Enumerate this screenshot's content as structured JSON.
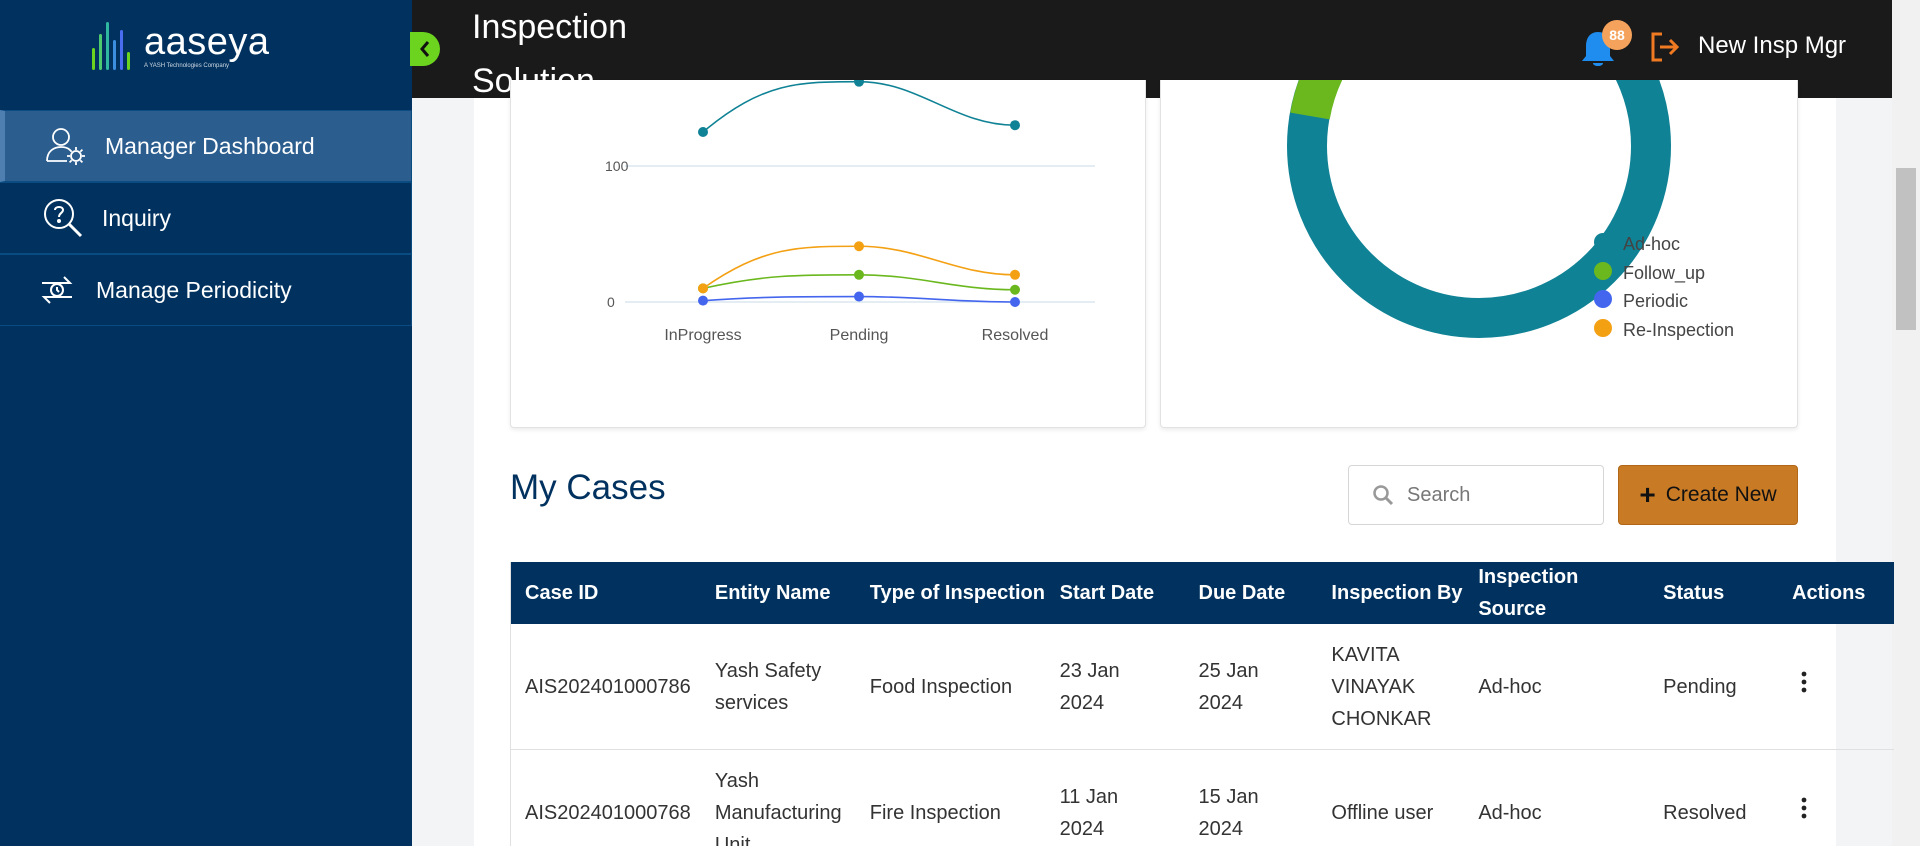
{
  "sidebar": {
    "logo": {
      "brand": "aaseya",
      "tagline": "A YASH Technologies Company"
    },
    "items": [
      {
        "label": "Manager Dashboard",
        "icon": "user-gear-icon",
        "active": true
      },
      {
        "label": "Inquiry",
        "icon": "search-question-icon",
        "active": false
      },
      {
        "label": "Manage Periodicity",
        "icon": "periodicity-icon",
        "active": false
      }
    ]
  },
  "header": {
    "title_line1": "Inspection",
    "title_line2": "Solution",
    "notification_count": "88",
    "username": "New Insp Mgr"
  },
  "colors": {
    "sidebar_bg": "#01325f",
    "header_bg": "#1a1a1a",
    "accent_green": "#6cd31e",
    "create_button": "#c97a25",
    "adhoc": "#0f8295",
    "follow_up": "#6ab81e",
    "periodic": "#4466ee",
    "re_inspection": "#f4a013"
  },
  "chart_data": [
    {
      "type": "line",
      "categories": [
        "InProgress",
        "Pending",
        "Resolved"
      ],
      "y_ticks": [
        "100",
        "0"
      ],
      "series": [
        {
          "name": "Ad-hoc",
          "color": "#0f8295",
          "values": [
            125,
            162,
            130
          ]
        },
        {
          "name": "Follow_up",
          "color": "#6ab81e",
          "values": [
            10,
            20,
            9
          ]
        },
        {
          "name": "Periodic",
          "color": "#4466ee",
          "values": [
            1,
            4,
            0
          ]
        },
        {
          "name": "Re-Inspection",
          "color": "#f4a013",
          "values": [
            10,
            41,
            20
          ]
        }
      ]
    },
    {
      "type": "pie",
      "legend": [
        "Ad-hoc",
        "Follow_up",
        "Periodic",
        "Re-Inspection"
      ],
      "legend_colors": [
        "#0f8295",
        "#6ab81e",
        "#4466ee",
        "#f4a013"
      ]
    }
  ],
  "cases": {
    "title": "My Cases",
    "search_placeholder": "Search",
    "create_label": "Create New",
    "columns": [
      "Case ID",
      "Entity Name",
      "Type of Inspection",
      "Start Date",
      "Due Date",
      "Inspection By",
      "Inspection Source",
      "Status",
      "Actions"
    ],
    "rows": [
      {
        "case_id": "AIS202401000786",
        "entity_l1": "Yash Safety",
        "entity_l2": "services",
        "entity_l3": "",
        "type": "Food Inspection",
        "start_l1": "23 Jan",
        "start_l2": "2024",
        "due_l1": "25 Jan",
        "due_l2": "2024",
        "by_l1": "KAVITA",
        "by_l2": "VINAYAK",
        "by_l3": "CHONKAR",
        "source": "Ad-hoc",
        "status": "Pending"
      },
      {
        "case_id": "AIS202401000768",
        "entity_l1": "Yash",
        "entity_l2": "Manufacturing",
        "entity_l3": "Unit",
        "type": "Fire Inspection",
        "start_l1": "11 Jan",
        "start_l2": "2024",
        "due_l1": "15 Jan",
        "due_l2": "2024",
        "by_l1": "Offline user",
        "by_l2": "",
        "by_l3": "",
        "source": "Ad-hoc",
        "status": "Resolved"
      }
    ]
  }
}
